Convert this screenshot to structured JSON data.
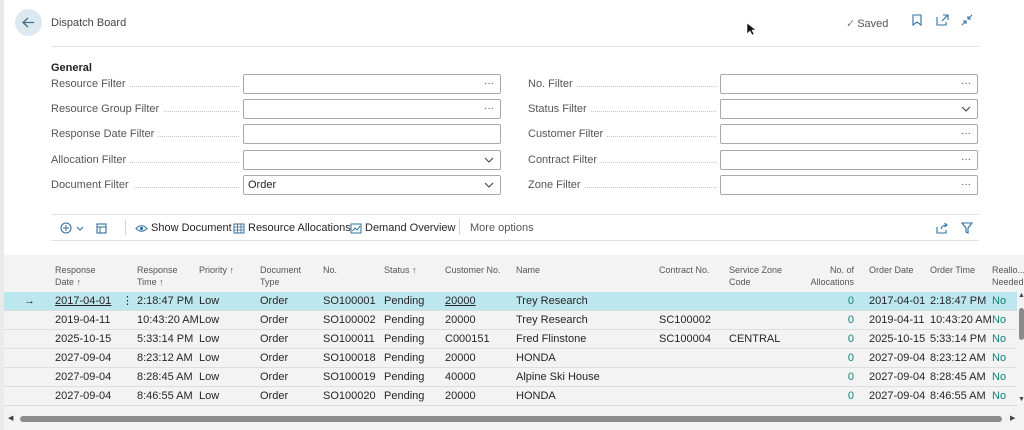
{
  "header": {
    "title": "Dispatch Board",
    "saved": "Saved",
    "back_icon": "arrow-left-icon",
    "icons": [
      "bookmark-icon",
      "open-new-window-icon",
      "collapse-icon"
    ]
  },
  "general": {
    "title": "General",
    "left_filters": [
      {
        "label": "Resource Filter",
        "value": "",
        "tail": "···"
      },
      {
        "label": "Resource Group Filter",
        "value": "",
        "tail": "···"
      },
      {
        "label": "Response Date Filter",
        "value": "",
        "tail": ""
      },
      {
        "label": "Allocation Filter",
        "value": "",
        "tail": "⌵"
      },
      {
        "label": "Document Filter",
        "value": "Order",
        "tail": "⌵"
      }
    ],
    "right_filters": [
      {
        "label": "No. Filter",
        "value": "",
        "tail": "···"
      },
      {
        "label": "Status Filter",
        "value": "",
        "tail": "⌵"
      },
      {
        "label": "Customer Filter",
        "value": "",
        "tail": "···"
      },
      {
        "label": "Contract Filter",
        "value": "",
        "tail": "···"
      },
      {
        "label": "Zone Filter",
        "value": "",
        "tail": "···"
      }
    ]
  },
  "toolbar": {
    "show_document": "Show Document",
    "resource_allocations": "Resource Allocations",
    "demand_overview": "Demand Overview",
    "more_options": "More options"
  },
  "grid": {
    "headers": {
      "response_date": [
        "Response",
        "Date ↑"
      ],
      "response_time": [
        "Response",
        "Time ↑"
      ],
      "priority": [
        "Priority ↑"
      ],
      "document_type": [
        "Document",
        "Type"
      ],
      "no": [
        "No."
      ],
      "status": [
        "Status ↑"
      ],
      "customer_no": [
        "Customer No."
      ],
      "name": [
        "Name"
      ],
      "contract_no": [
        "Contract No."
      ],
      "service_zone": [
        "Service Zone",
        "Code"
      ],
      "no_allocations": [
        "No. of",
        "Allocations"
      ],
      "order_date": [
        "Order Date"
      ],
      "order_time": [
        "Order Time"
      ],
      "realloc": [
        "Reallo...",
        "Needed"
      ]
    },
    "rows": [
      {
        "response_date": "2017-04-01",
        "response_time": "2:18:47 PM",
        "priority": "Low",
        "document_type": "Order",
        "no": "SO100001",
        "status": "Pending",
        "customer_no": "20000",
        "name": "Trey Research",
        "contract_no": "",
        "service_zone": "",
        "no_allocations": "0",
        "order_date": "2017-04-01",
        "order_time": "2:18:47 PM",
        "realloc": "No"
      },
      {
        "response_date": "2019-04-11",
        "response_time": "10:43:20 AM",
        "priority": "Low",
        "document_type": "Order",
        "no": "SO100002",
        "status": "Pending",
        "customer_no": "20000",
        "name": "Trey Research",
        "contract_no": "SC100002",
        "service_zone": "",
        "no_allocations": "0",
        "order_date": "2019-04-11",
        "order_time": "10:43:20 AM",
        "realloc": "No"
      },
      {
        "response_date": "2025-10-15",
        "response_time": "5:33:14 PM",
        "priority": "Low",
        "document_type": "Order",
        "no": "SO100011",
        "status": "Pending",
        "customer_no": "C000151",
        "name": "Fred Flinstone",
        "contract_no": "SC100004",
        "service_zone": "CENTRAL",
        "no_allocations": "0",
        "order_date": "2025-10-15",
        "order_time": "5:33:14 PM",
        "realloc": "No"
      },
      {
        "response_date": "2027-09-04",
        "response_time": "8:23:12 AM",
        "priority": "Low",
        "document_type": "Order",
        "no": "SO100018",
        "status": "Pending",
        "customer_no": "20000",
        "name": "HONDA",
        "contract_no": "",
        "service_zone": "",
        "no_allocations": "0",
        "order_date": "2027-09-04",
        "order_time": "8:23:12 AM",
        "realloc": "No"
      },
      {
        "response_date": "2027-09-04",
        "response_time": "8:28:45 AM",
        "priority": "Low",
        "document_type": "Order",
        "no": "SO100019",
        "status": "Pending",
        "customer_no": "40000",
        "name": "Alpine Ski House",
        "contract_no": "",
        "service_zone": "",
        "no_allocations": "0",
        "order_date": "2027-09-04",
        "order_time": "8:28:45 AM",
        "realloc": "No"
      },
      {
        "response_date": "2027-09-04",
        "response_time": "8:46:55 AM",
        "priority": "Low",
        "document_type": "Order",
        "no": "SO100020",
        "status": "Pending",
        "customer_no": "20000",
        "name": "HONDA",
        "contract_no": "",
        "service_zone": "",
        "no_allocations": "0",
        "order_date": "2027-09-04",
        "order_time": "8:46:55 AM",
        "realloc": "No"
      }
    ]
  },
  "colors": {
    "accent": "#2f6f9f",
    "selected_row": "#bde7ee",
    "link_teal": "#108279"
  }
}
